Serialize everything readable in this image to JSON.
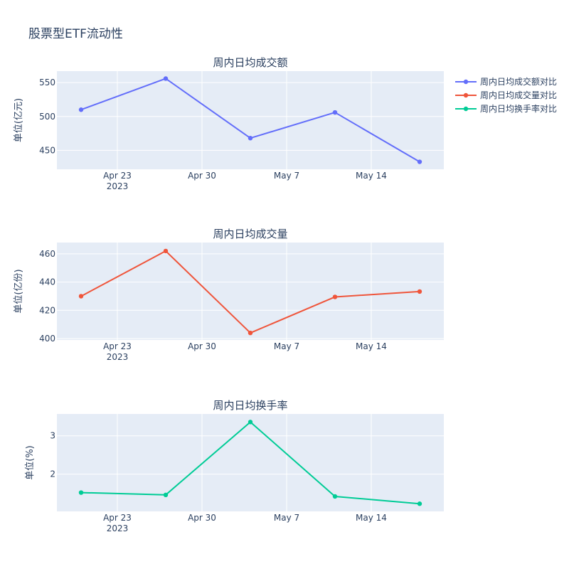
{
  "page_title": "股票型ETF流动性",
  "chart_data": [
    {
      "type": "line",
      "title": "周内日均成交额",
      "ylabel": "单位(亿元)",
      "color": "#636efa",
      "x": [
        "2023-04-20",
        "2023-04-27",
        "2023-05-04",
        "2023-05-11",
        "2023-05-18"
      ],
      "values": [
        510,
        556,
        468,
        506,
        433
      ],
      "ylim": [
        422,
        567
      ],
      "yticks": [
        450,
        500,
        550
      ],
      "legend": "周内日均成交额对比"
    },
    {
      "type": "line",
      "title": "周内日均成交量",
      "ylabel": "单位(亿份)",
      "color": "#ef553b",
      "x": [
        "2023-04-20",
        "2023-04-27",
        "2023-05-04",
        "2023-05-11",
        "2023-05-18"
      ],
      "values": [
        430,
        462,
        404,
        429.5,
        433.3
      ],
      "ylim": [
        399,
        468
      ],
      "yticks": [
        400,
        420,
        440,
        460
      ],
      "legend": "周内日均成交量对比"
    },
    {
      "type": "line",
      "title": "周内日均换手率",
      "ylabel": "单位(%)",
      "color": "#00cc96",
      "x": [
        "2023-04-20",
        "2023-04-27",
        "2023-05-04",
        "2023-05-11",
        "2023-05-18"
      ],
      "values": [
        1.52,
        1.46,
        3.36,
        1.42,
        1.23
      ],
      "ylim": [
        1.03,
        3.57
      ],
      "yticks": [
        2,
        3
      ],
      "legend": "周内日均换手率对比"
    }
  ],
  "x_axis": {
    "range": [
      "2023-04-18",
      "2023-05-20"
    ],
    "ticks": [
      {
        "date": "2023-04-23",
        "label": "Apr 23",
        "sub": "2023"
      },
      {
        "date": "2023-04-30",
        "label": "Apr 30",
        "sub": ""
      },
      {
        "date": "2023-05-07",
        "label": "May 7",
        "sub": ""
      },
      {
        "date": "2023-05-14",
        "label": "May 14",
        "sub": ""
      }
    ]
  },
  "grid": true,
  "legend_position": "top-right"
}
